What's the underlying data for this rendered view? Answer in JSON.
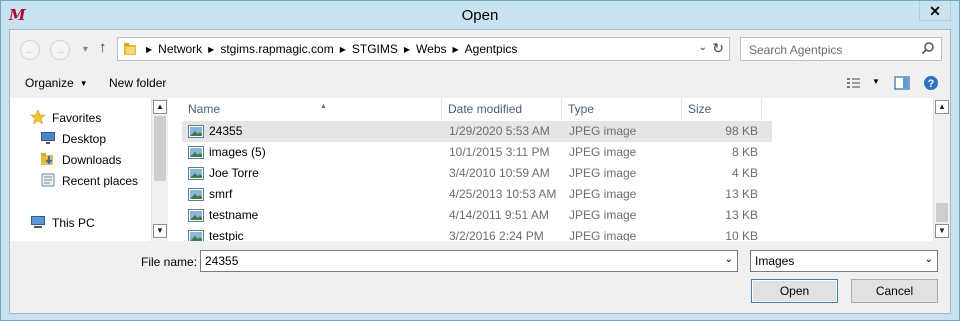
{
  "window": {
    "title": "Open",
    "close_label": "✕"
  },
  "nav": {
    "back_icon": "back-arrow-icon",
    "forward_icon": "forward-arrow-icon",
    "breadcrumbs": [
      "Network",
      "stgims.rapmagic.com",
      "STGIMS",
      "Webs",
      "Agentpics"
    ],
    "search_placeholder": "Search Agentpics"
  },
  "toolbar": {
    "organize_label": "Organize",
    "new_folder_label": "New folder"
  },
  "sidebar": {
    "items": [
      {
        "label": "Favorites",
        "icon": "star-icon"
      },
      {
        "label": "Desktop",
        "icon": "desktop-icon"
      },
      {
        "label": "Downloads",
        "icon": "downloads-icon"
      },
      {
        "label": "Recent places",
        "icon": "recent-places-icon"
      },
      {
        "label": "This PC",
        "icon": "computer-icon"
      }
    ]
  },
  "file_list": {
    "columns": [
      "Name",
      "Date modified",
      "Type",
      "Size"
    ],
    "rows": [
      {
        "name": "24355",
        "date": "1/29/2020 5:53 AM",
        "type": "JPEG image",
        "size": "98 KB"
      },
      {
        "name": "images (5)",
        "date": "10/1/2015 3:11 PM",
        "type": "JPEG image",
        "size": "8 KB"
      },
      {
        "name": "Joe Torre",
        "date": "3/4/2010 10:59 AM",
        "type": "JPEG image",
        "size": "4 KB"
      },
      {
        "name": "smrf",
        "date": "4/25/2013 10:53 AM",
        "type": "JPEG image",
        "size": "13 KB"
      },
      {
        "name": "testname",
        "date": "4/14/2011 9:51 AM",
        "type": "JPEG image",
        "size": "13 KB"
      },
      {
        "name": "testpic",
        "date": "3/2/2016 2:24 PM",
        "type": "JPEG image",
        "size": "10 KB"
      }
    ]
  },
  "bottom": {
    "file_name_label": "File name:",
    "file_name_value": "24355",
    "file_type_value": "Images",
    "open_label": "Open",
    "cancel_label": "Cancel"
  },
  "colors": {
    "frame": "#c9e2ef",
    "client": "#f0f0f0",
    "header_text": "#4c607a",
    "selected_row": "#e5e5e5"
  }
}
